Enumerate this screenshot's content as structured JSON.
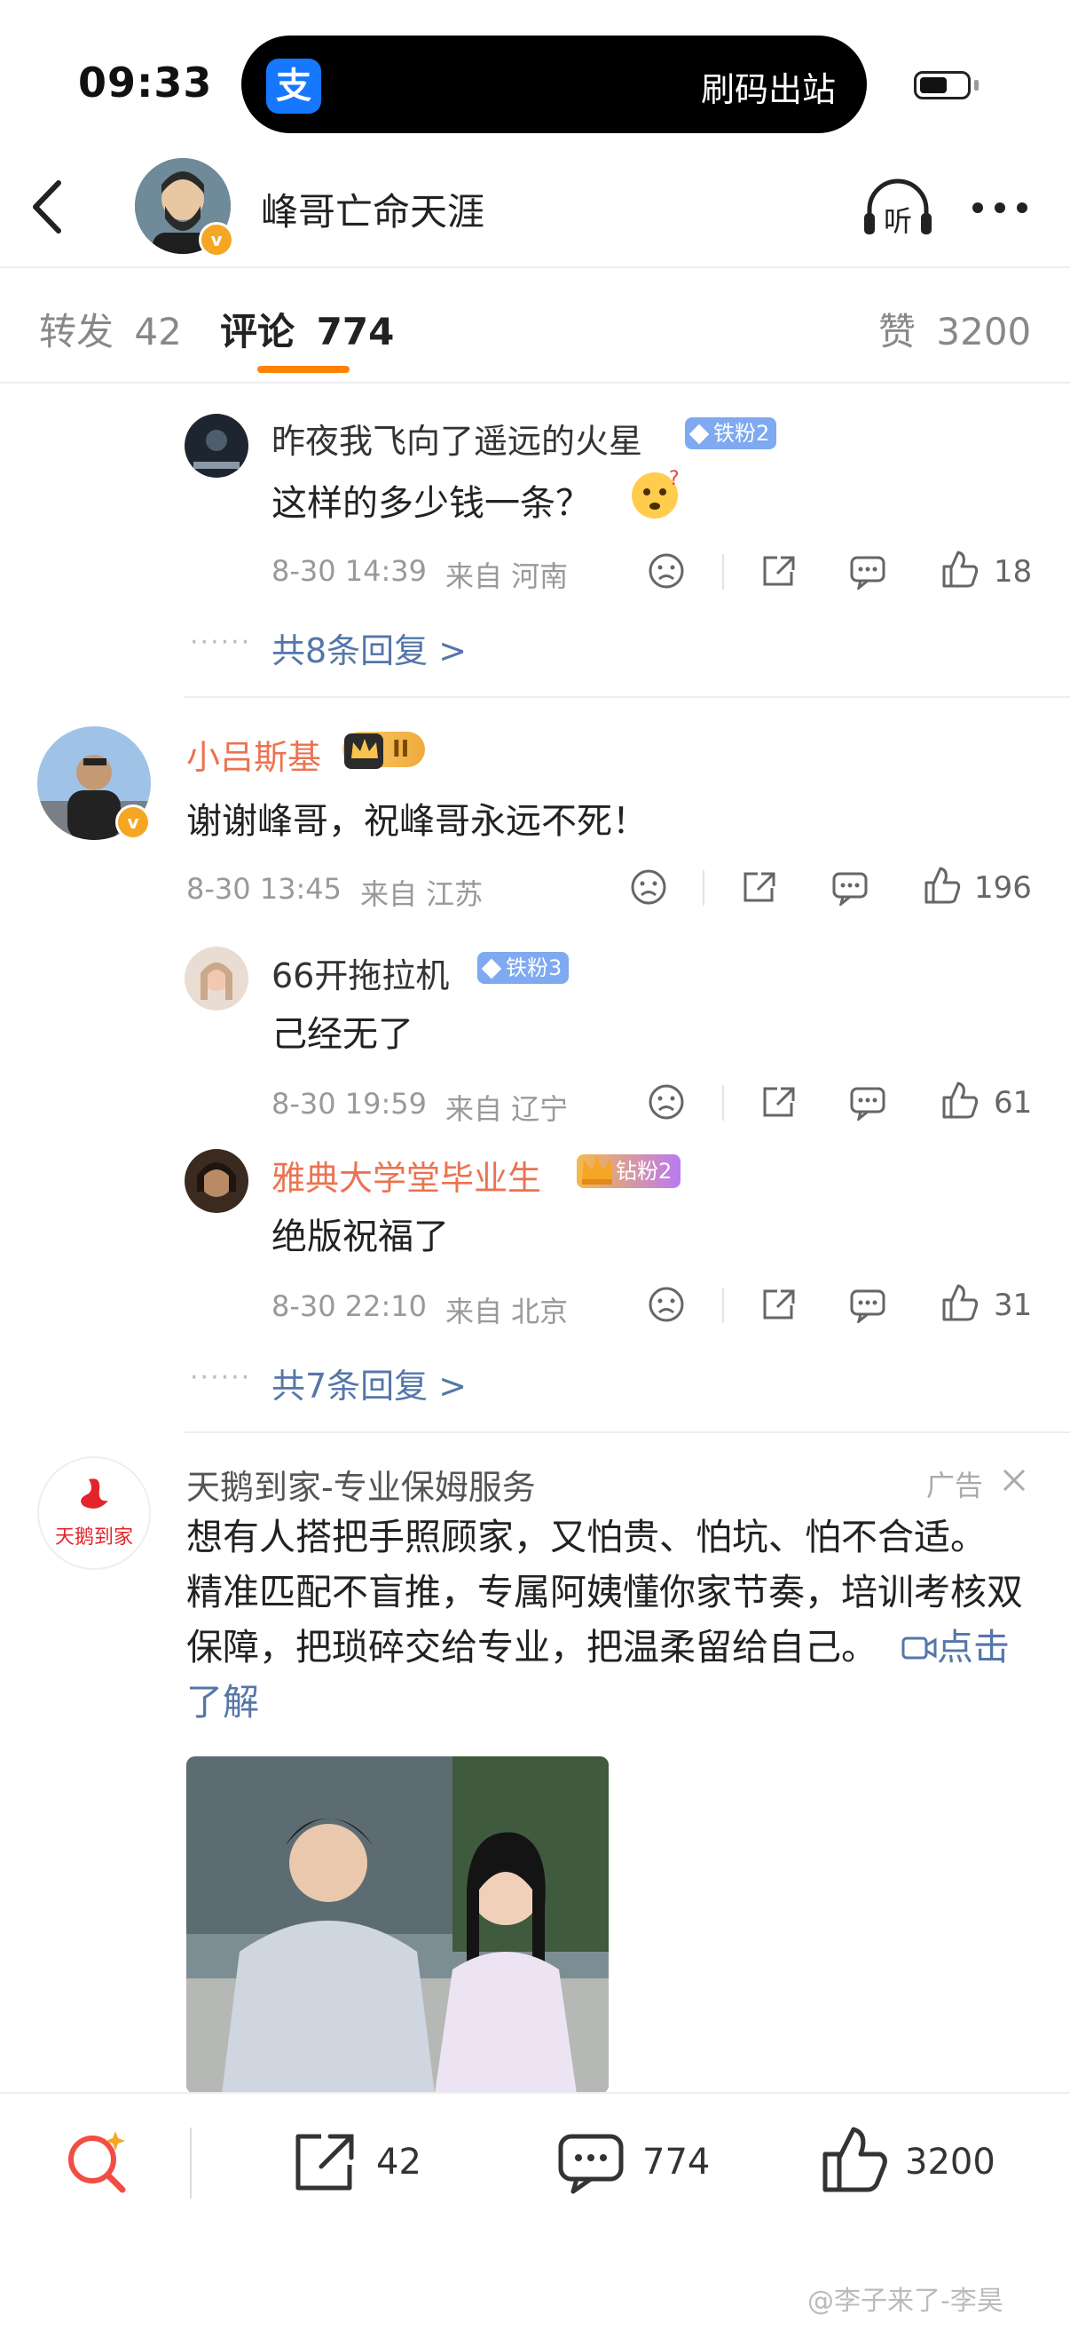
{
  "status_bar": {
    "time": "09:33",
    "island_app_icon": "支",
    "island_text": "刷码出站"
  },
  "header": {
    "title": "峰哥亡命天涯",
    "listen_label": "听"
  },
  "tabs": [
    {
      "label": "转发",
      "count": "42"
    },
    {
      "label": "评论",
      "count": "774"
    },
    {
      "label": "赞",
      "count": "3200"
    }
  ],
  "comments": {
    "c1": {
      "user": "昨夜我飞向了遥远的火星",
      "badge": "铁粉2",
      "text": "这样的多少钱一条？",
      "time": "8-30 14:39",
      "location": "来自 河南",
      "likes": "18",
      "more_replies": "共8条回复 >"
    },
    "c2": {
      "user": "小吕斯基",
      "badge": "II",
      "text": "谢谢峰哥，祝峰哥永远不死！",
      "time": "8-30 13:45",
      "location": "来自 江苏",
      "likes": "196",
      "more_replies": "共7条回复 >",
      "replies": [
        {
          "user": "66开拖拉机",
          "badge": "铁粉3",
          "text": "己经无了",
          "time": "8-30 19:59",
          "location": "来自 辽宁",
          "likes": "61"
        },
        {
          "user": "雅典大学堂毕业生",
          "badge": "钻粉2",
          "text": "绝版祝福了",
          "time": "8-30 22:10",
          "location": "来自 北京",
          "likes": "31"
        }
      ]
    }
  },
  "ad": {
    "logo_text": "天鹅到家",
    "advertiser": "天鹅到家-专业保姆服务",
    "ad_label": "广告",
    "text": "想有人搭把手照顾家，又怕贵、怕坑、怕不合适。 精准匹配不盲推，专属阿姨懂你家节奏，培训考核双保障，把琐碎交给专业，把温柔留给自己。",
    "link_label": "点击了解"
  },
  "bottom_bar": {
    "reposts": "42",
    "comments": "774",
    "likes": "3200"
  },
  "watermark": "@李子来了-李昊",
  "colors": {
    "accent": "#ff8200",
    "link": "#5576a8",
    "vip_name": "#eb7350",
    "fan_badge": "#7fa9f0"
  }
}
